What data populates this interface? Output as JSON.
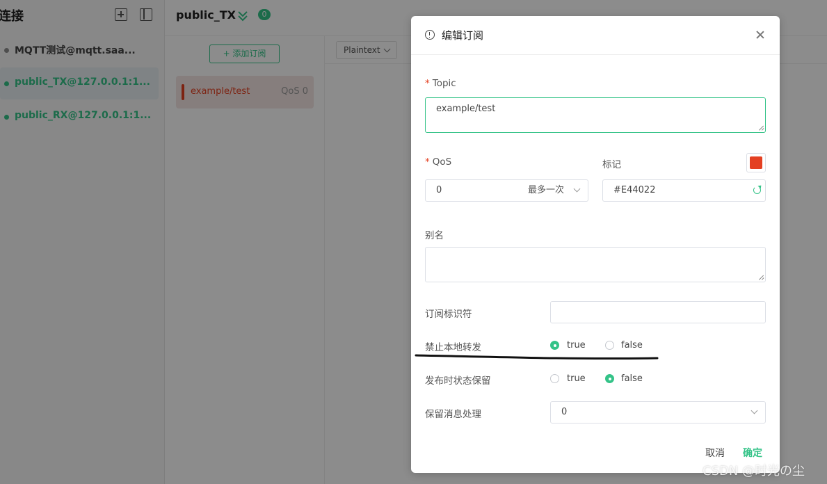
{
  "sidebar": {
    "title": "连接",
    "connections": [
      {
        "name": "MQTT测试@mqtt.saa...",
        "status_color": "#8f8f8f",
        "active": false
      },
      {
        "name": "public_TX@127.0.0.1:1...",
        "status_color": "#34c388",
        "active": true
      },
      {
        "name": "public_RX@127.0.0.1:1...",
        "status_color": "#34c388",
        "active": false
      }
    ]
  },
  "header": {
    "connection_name": "public_TX",
    "badge_count": "0"
  },
  "subscriptions": {
    "add_label": "+ 添加订阅",
    "items": [
      {
        "topic": "example/test",
        "qos": "QoS 0",
        "color": "#e44022"
      }
    ]
  },
  "messages": {
    "format": "Plaintext"
  },
  "dialog": {
    "title": "编辑订阅",
    "required_mark": "*",
    "topic_label": "Topic",
    "topic_value": "example/test",
    "qos_label": "QoS",
    "qos_value": "0",
    "qos_desc": "最多一次",
    "mark_label": "标记",
    "mark_color": "#E44022",
    "alias_label": "别名",
    "alias_value": "",
    "sub_id_label": "订阅标识符",
    "sub_id_value": "",
    "no_local_label": "禁止本地转发",
    "no_local_value": "true",
    "retain_as_pub_label": "发布时状态保留",
    "retain_as_pub_value": "false",
    "retain_handling_label": "保留消息处理",
    "retain_handling_value": "0",
    "option_true": "true",
    "option_false": "false",
    "cancel_label": "取消",
    "confirm_label": "确定"
  },
  "watermark": "CSDN @时光の尘",
  "colors": {
    "accent": "#34c388",
    "mark": "#e44022",
    "overlay": "rgba(0,0,0,0.45)"
  }
}
